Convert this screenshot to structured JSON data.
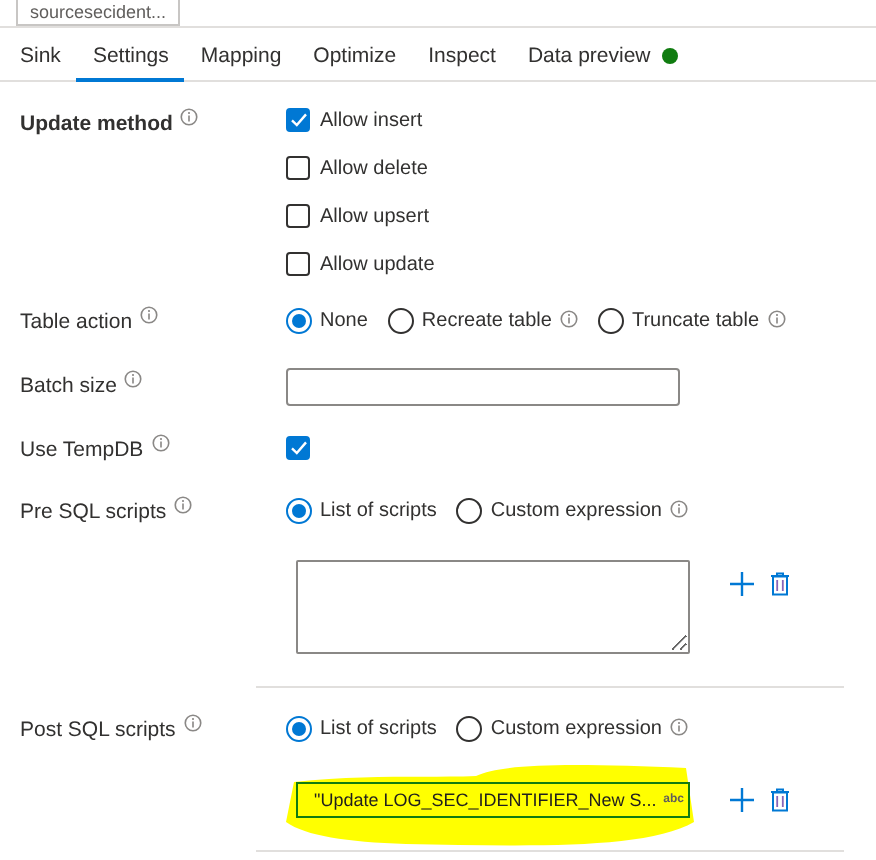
{
  "top_tab": {
    "label": "sourcesecident..."
  },
  "tabs": [
    {
      "label": "Sink",
      "selected": false,
      "dot": false
    },
    {
      "label": "Settings",
      "selected": true,
      "dot": false
    },
    {
      "label": "Mapping",
      "selected": false,
      "dot": false
    },
    {
      "label": "Optimize",
      "selected": false,
      "dot": false
    },
    {
      "label": "Inspect",
      "selected": false,
      "dot": false
    },
    {
      "label": "Data preview",
      "selected": false,
      "dot": true
    }
  ],
  "settings": [
    {
      "label": "Update method",
      "info": true,
      "kind": "checkboxes",
      "options": [
        {
          "label": "Allow insert",
          "checked": true
        },
        {
          "label": "Allow delete",
          "checked": false
        },
        {
          "label": "Allow upsert",
          "checked": false
        },
        {
          "label": "Allow update",
          "checked": false
        }
      ]
    },
    {
      "label": "Table action",
      "info": true,
      "kind": "radios",
      "options": [
        {
          "label": "None",
          "selected": true,
          "info": false
        },
        {
          "label": "Recreate table",
          "selected": false,
          "info": true
        },
        {
          "label": "Truncate table",
          "selected": false,
          "info": true
        }
      ]
    },
    {
      "label": "Batch size",
      "info": true,
      "kind": "text"
    },
    {
      "label": "Use TempDB",
      "info": true,
      "kind": "checkbox",
      "checked": true
    },
    {
      "label": "Pre SQL scripts",
      "info": true,
      "kind": "scripts",
      "options": [
        {
          "label": "List of scripts",
          "selected": true,
          "info": false
        },
        {
          "label": "Custom expression",
          "selected": false,
          "info": true
        }
      ],
      "entry": {
        "kind": "textarea",
        "highlighted": false
      }
    },
    {
      "label": "Post SQL scripts",
      "info": true,
      "kind": "scripts",
      "options": [
        {
          "label": "List of scripts",
          "selected": true,
          "info": false
        },
        {
          "label": "Custom expression",
          "selected": false,
          "info": true
        }
      ],
      "entry": {
        "kind": "input",
        "value": "\"Update LOG_SEC_IDENTIFIER_New S...",
        "badge": "abc",
        "highlighted": true
      }
    }
  ]
}
